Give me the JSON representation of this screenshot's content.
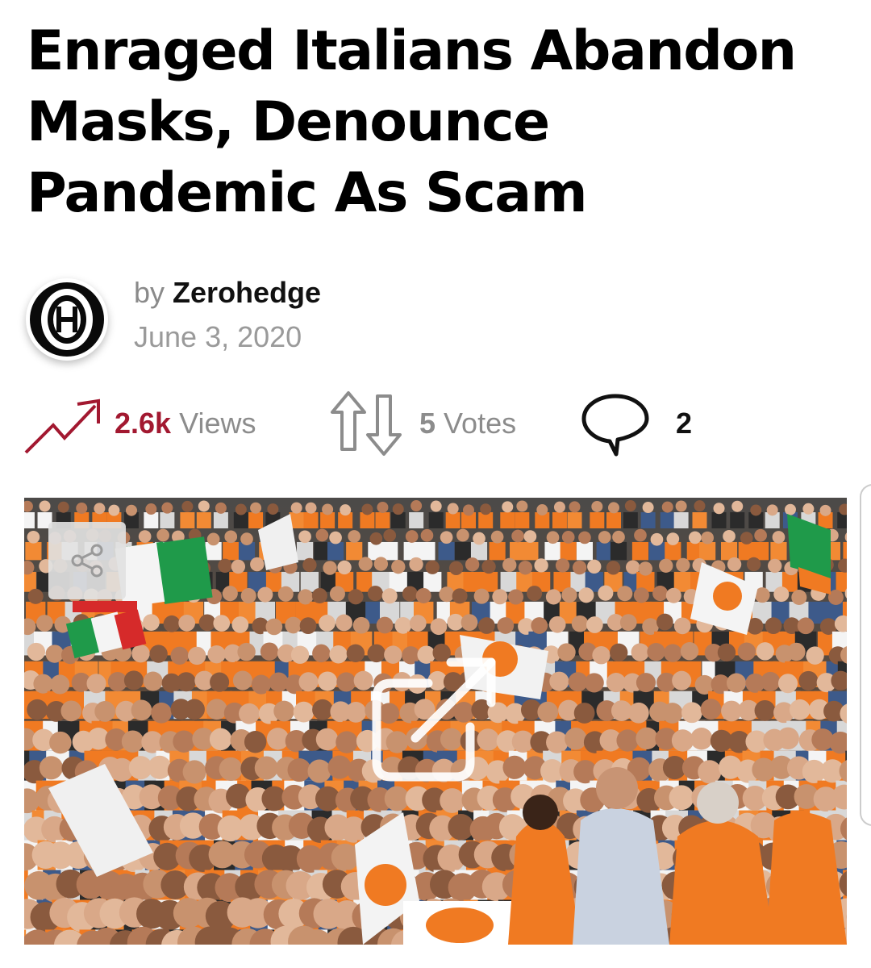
{
  "article": {
    "title_lines": [
      "Enraged Italians Abandon",
      "Masks, Denounce",
      "Pandemic As Scam"
    ],
    "byline_prefix": "by",
    "author": "Zerohedge",
    "date": "June 3, 2020"
  },
  "stats": {
    "views_count": "2.6k",
    "views_label": "Views",
    "votes_count": "5",
    "votes_label": "Votes",
    "comments_count": "2"
  },
  "colors": {
    "accent_red": "#a21830",
    "muted_gray": "#8c8c8c",
    "photo_orange": "#f07a22",
    "flag_green": "#1f9a4a",
    "flag_red": "#d62a2a"
  },
  "icons": {
    "avatar": "zerohedge-logo-icon",
    "views": "trending-up-icon",
    "votes": "updown-arrows-icon",
    "comments": "comment-bubble-icon",
    "share": "share-icon",
    "open": "open-external-icon"
  }
}
